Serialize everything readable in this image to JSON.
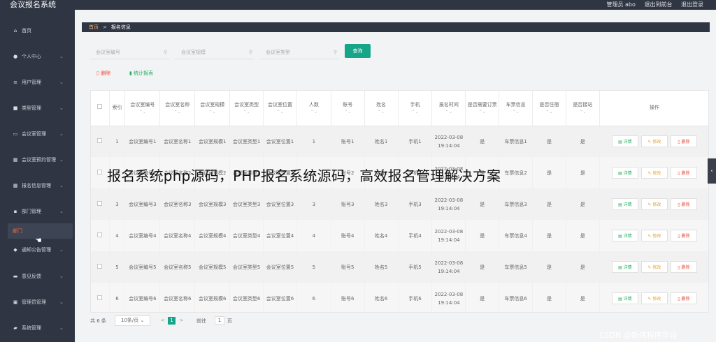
{
  "app": {
    "title": "会议报名系统",
    "user": "管理员 abo",
    "back_to_front": "退出到前台",
    "logout": "退出登录"
  },
  "sidebar": {
    "items": [
      {
        "label": "首页",
        "icon": "home-icon",
        "glyph": "⌂"
      },
      {
        "label": "个人中心",
        "icon": "person-icon",
        "glyph": "●"
      },
      {
        "label": "用户管理",
        "icon": "list-icon",
        "glyph": "≡"
      },
      {
        "label": "类型管理",
        "icon": "folder-icon",
        "glyph": "■"
      },
      {
        "label": "会议室管理",
        "icon": "monitor-icon",
        "glyph": "▭"
      },
      {
        "label": "会议室预约管理",
        "icon": "calendar-icon",
        "glyph": "▦"
      },
      {
        "label": "报名信息管理",
        "icon": "grid-icon",
        "glyph": "▦"
      },
      {
        "label": "部门管理",
        "icon": "org-icon",
        "glyph": "▪"
      },
      {
        "label": "通知公告管理",
        "icon": "bell-icon",
        "glyph": "◆"
      },
      {
        "label": "意见反馈",
        "icon": "chat-icon",
        "glyph": "▬"
      },
      {
        "label": "管理员管理",
        "icon": "admin-icon",
        "glyph": "▣"
      },
      {
        "label": "系统管理",
        "icon": "settings-icon",
        "glyph": "▰"
      }
    ],
    "subitem": "部门",
    "chevron": "⌄"
  },
  "breadcrumb": {
    "home": "首页",
    "separator": ">",
    "current": "报名信息"
  },
  "search": {
    "field1": "会议室编号",
    "field2": "会议室规模",
    "field3": "会议室类型",
    "button": "查询"
  },
  "toolbar": {
    "delete": "删除",
    "stats": "统计报表"
  },
  "table": {
    "headers": [
      "索引",
      "会议室编号",
      "会议室名称",
      "会议室规模",
      "会议室类型",
      "会议室位置",
      "人数",
      "账号",
      "姓名",
      "手机",
      "报名时间",
      "是否需要订票",
      "车票信息",
      "是否住宿",
      "是否接站",
      "操作"
    ],
    "rows": [
      {
        "index": "1",
        "code": "会议室编号1",
        "name": "会议室名称1",
        "scale": "会议室规模1",
        "type": "会议室类型1",
        "location": "会议室位置1",
        "people": "1",
        "account": "账号1",
        "uname": "姓名1",
        "phone": "手机1",
        "time": "2022-03-08 19:14:04",
        "ticket": "是",
        "ticket_info": "车票信息1",
        "stay": "是",
        "pickup": "是"
      },
      {
        "index": "2",
        "code": "会议室编号2",
        "name": "会议室名称2",
        "scale": "会议室规模2",
        "type": "会议室类型2",
        "location": "会议室位置2",
        "people": "2",
        "account": "账号2",
        "uname": "姓名2",
        "phone": "手机2",
        "time": "2022-03-08 19:14:04",
        "ticket": "是",
        "ticket_info": "车票信息2",
        "stay": "是",
        "pickup": "是"
      },
      {
        "index": "3",
        "code": "会议室编号3",
        "name": "会议室名称3",
        "scale": "会议室规模3",
        "type": "会议室类型3",
        "location": "会议室位置3",
        "people": "3",
        "account": "账号3",
        "uname": "姓名3",
        "phone": "手机3",
        "time": "2022-03-08 19:14:04",
        "ticket": "是",
        "ticket_info": "车票信息3",
        "stay": "是",
        "pickup": "是"
      },
      {
        "index": "4",
        "code": "会议室编号4",
        "name": "会议室名称4",
        "scale": "会议室规模4",
        "type": "会议室类型4",
        "location": "会议室位置4",
        "people": "4",
        "account": "账号4",
        "uname": "姓名4",
        "phone": "手机4",
        "time": "2022-03-08 19:14:04",
        "ticket": "是",
        "ticket_info": "车票信息4",
        "stay": "是",
        "pickup": "是"
      },
      {
        "index": "5",
        "code": "会议室编号5",
        "name": "会议室名称5",
        "scale": "会议室规模5",
        "type": "会议室类型5",
        "location": "会议室位置5",
        "people": "5",
        "account": "账号5",
        "uname": "姓名5",
        "phone": "手机5",
        "time": "2022-03-08 19:14:04",
        "ticket": "是",
        "ticket_info": "车票信息5",
        "stay": "是",
        "pickup": "是"
      },
      {
        "index": "6",
        "code": "会议室编号6",
        "name": "会议室名称6",
        "scale": "会议室规模6",
        "type": "会议室类型6",
        "location": "会议室位置6",
        "people": "6",
        "account": "账号6",
        "uname": "姓名6",
        "phone": "手机6",
        "time": "2022-03-08 19:14:04",
        "ticket": "是",
        "ticket_info": "车票信息6",
        "stay": "是",
        "pickup": "是"
      }
    ],
    "actions": {
      "view": "详情",
      "edit": "修改",
      "delete": "删除"
    }
  },
  "pager": {
    "total": "共 6 条",
    "page_size": "10条/页",
    "prev": "<",
    "current": "1",
    "next": ">",
    "goto_label": "前往",
    "goto_value": "1",
    "page_suffix": "页"
  },
  "overlay_title": "报名系统php源码，PHP报名系统源码，高效报名管理解决方案",
  "watermark": "CSDN @新伟程序毕设",
  "colors": {
    "sidebar": "#2f3542",
    "accent": "#17a589",
    "danger": "#e74c3c",
    "warning": "#e6a23c"
  }
}
